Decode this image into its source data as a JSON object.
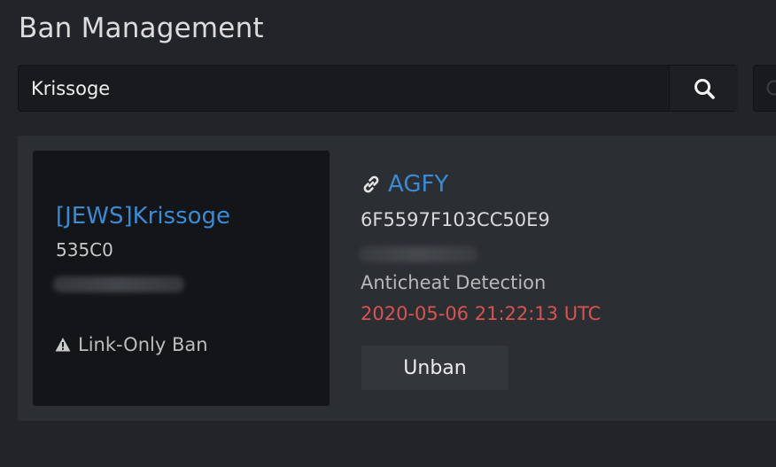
{
  "page": {
    "title": "Ban Management"
  },
  "search": {
    "value": "Krissoge",
    "icon": "search-icon"
  },
  "ban": {
    "player_name": "[JEWS]Krissoge",
    "player_code": "535C0",
    "ban_type": "Link-Only Ban",
    "team": "AGFY",
    "guid": "6F5597F103CC50E9",
    "reason": "Anticheat Detection",
    "date": "2020-05-06 21:22:13 UTC",
    "unban_label": "Unban"
  },
  "colors": {
    "link": "#3a8ad6",
    "danger": "#d9534f",
    "background": "#222429",
    "card": "#2b2e33",
    "panel": "#131518"
  }
}
